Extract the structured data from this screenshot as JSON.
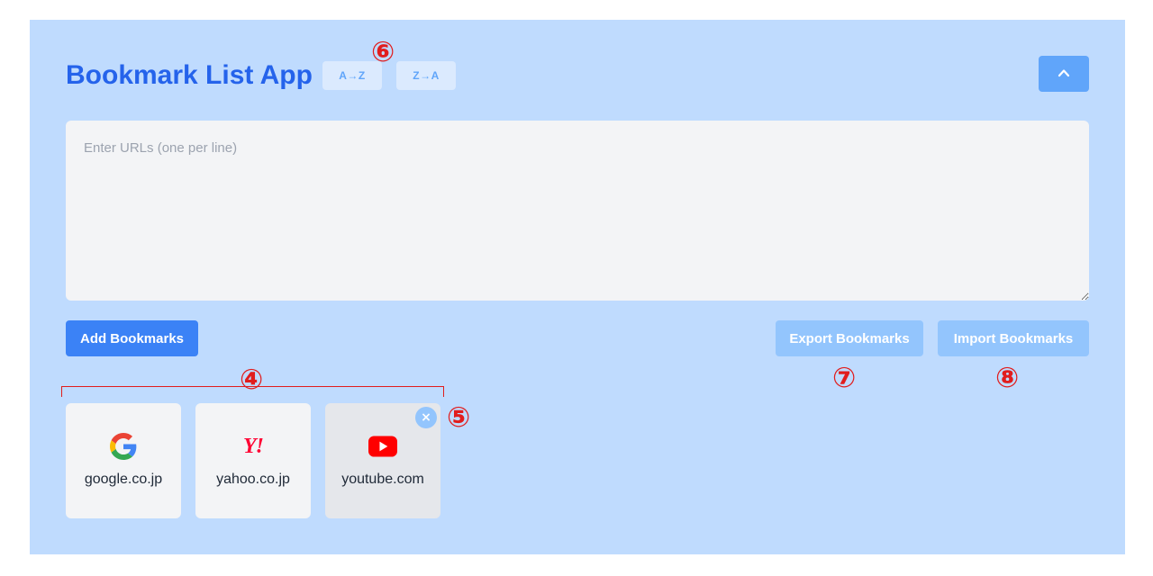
{
  "header": {
    "title": "Bookmark List App",
    "sort_az_label": "A→Z",
    "sort_za_label": "Z→A",
    "collapse_icon": "chevron-up-icon"
  },
  "input": {
    "placeholder": "Enter URLs (one per line)",
    "value": ""
  },
  "actions": {
    "add_label": "Add Bookmarks",
    "export_label": "Export Bookmarks",
    "import_label": "Import Bookmarks"
  },
  "bookmarks": [
    {
      "label": "google.co.jp",
      "icon": "google-icon"
    },
    {
      "label": "yahoo.co.jp",
      "icon": "yahoo-icon",
      "icon_text": "Y!"
    },
    {
      "label": "youtube.com",
      "icon": "youtube-icon",
      "remove_label": "×"
    }
  ],
  "annotations": {
    "m4": "④",
    "m5": "⑤",
    "m6": "⑥",
    "m7": "⑦",
    "m8": "⑧"
  },
  "colors": {
    "panel_bg": "#bfdbfe",
    "title": "#2563eb",
    "primary_button": "#3b82f6",
    "secondary_button": "#93c5fd",
    "annotation": "#e11d1d"
  }
}
